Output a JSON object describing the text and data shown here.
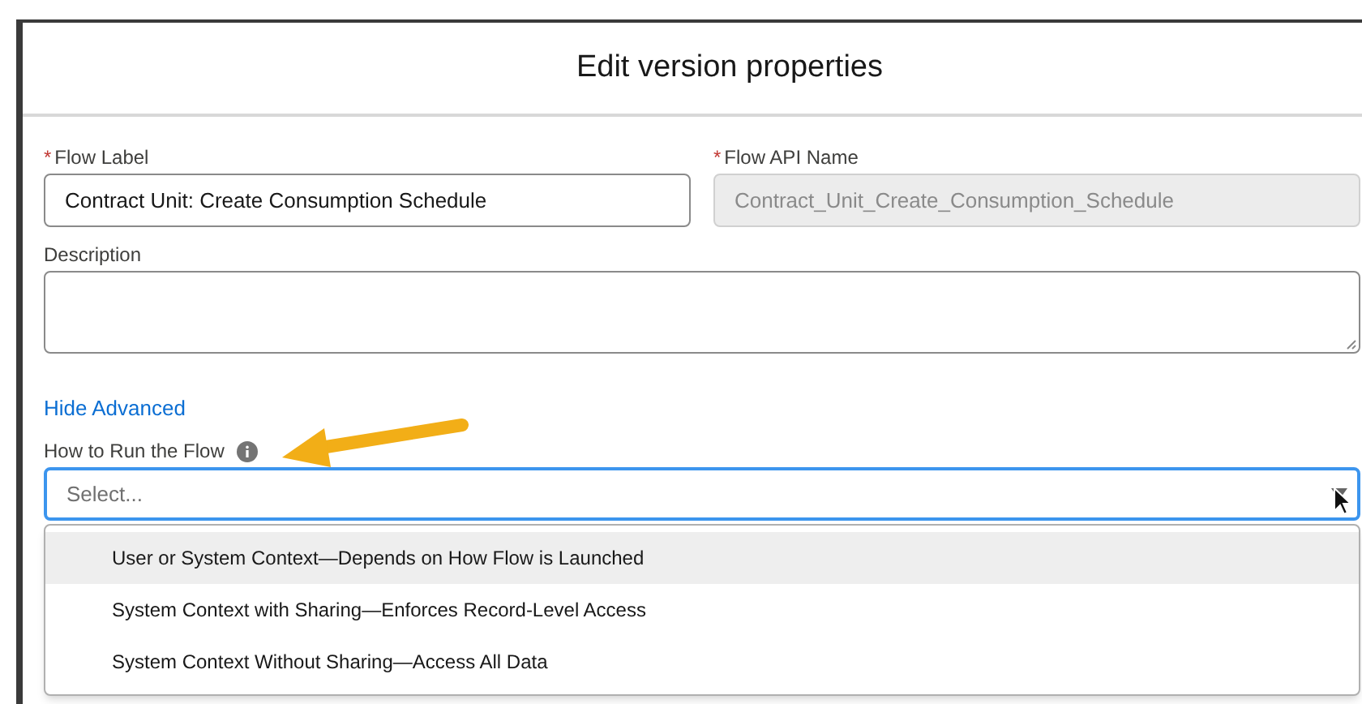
{
  "dialog": {
    "title": "Edit version properties"
  },
  "fields": [
    {
      "label": "Flow Label",
      "required_mark": "*",
      "value": "Contract Unit: Create Consumption Schedule",
      "disabled": false
    },
    {
      "label": "Flow API Name",
      "required_mark": "*",
      "value": "Contract_Unit_Create_Consumption_Schedule",
      "disabled": true
    }
  ],
  "description": {
    "label": "Description"
  },
  "advanced_toggle": "Hide Advanced",
  "run_mode": {
    "label": "How to Run the Flow",
    "placeholder": "Select...",
    "expanded": true,
    "options": [
      {
        "label": "User or System Context—Depends on How Flow is Launched",
        "highlighted": true
      },
      {
        "label": "System Context with Sharing—Enforces Record-Level Access",
        "highlighted": false
      },
      {
        "label": "System Context Without Sharing—Access All Data",
        "highlighted": false
      }
    ]
  }
}
